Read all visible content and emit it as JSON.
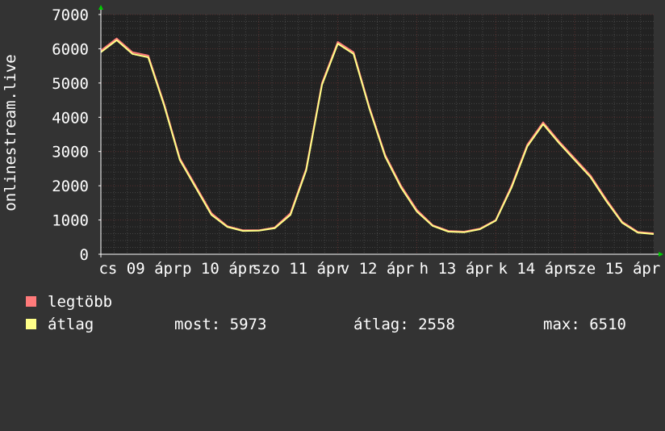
{
  "chart_data": {
    "type": "line",
    "ylabel": "onlinestream.live",
    "ylim": [
      0,
      7000
    ],
    "yticks": [
      0,
      1000,
      2000,
      3000,
      4000,
      5000,
      6000,
      7000
    ],
    "xticks": [
      "cs 09 ápr",
      "p 10 ápr",
      "szo 11 ápr",
      "v 12 ápr",
      "h 13 ápr",
      "k 14 ápr",
      "sze 15 ápr"
    ],
    "grid": true,
    "colors": {
      "background": "#333333",
      "plot": "#222222",
      "grid_major": "#5a3030",
      "grid_minor": "#444444",
      "axis": "#ffffff",
      "max_series": "#ff7a7a",
      "avg_series": "#ffff88"
    },
    "series": [
      {
        "name": "legtöbb",
        "color": "#ff7a7a",
        "x": [
          0.0,
          0.2,
          0.4,
          0.6,
          0.8,
          1.0,
          1.2,
          1.4,
          1.6,
          1.8,
          2.0,
          2.2,
          2.4,
          2.6,
          2.8,
          3.0,
          3.2,
          3.4,
          3.6,
          3.8,
          4.0,
          4.2,
          4.4,
          4.6,
          4.8,
          5.0,
          5.2,
          5.4,
          5.6,
          5.8,
          6.0,
          6.2,
          6.4,
          6.6,
          6.8,
          7.0
        ],
        "values": [
          5950,
          6300,
          5900,
          5800,
          4400,
          2800,
          2000,
          1200,
          820,
          700,
          700,
          780,
          1200,
          2500,
          5000,
          6200,
          5900,
          4300,
          2900,
          2000,
          1300,
          850,
          680,
          660,
          750,
          1000,
          2000,
          3200,
          3850,
          3300,
          2800,
          2300,
          1600,
          950,
          650,
          610
        ]
      },
      {
        "name": "átlag",
        "color": "#ffff88",
        "x": [
          0.0,
          0.2,
          0.4,
          0.6,
          0.8,
          1.0,
          1.2,
          1.4,
          1.6,
          1.8,
          2.0,
          2.2,
          2.4,
          2.6,
          2.8,
          3.0,
          3.2,
          3.4,
          3.6,
          3.8,
          4.0,
          4.2,
          4.4,
          4.6,
          4.8,
          5.0,
          5.2,
          5.4,
          5.6,
          5.8,
          6.0,
          6.2,
          6.4,
          6.6,
          6.8,
          7.0
        ],
        "values": [
          5900,
          6250,
          5850,
          5750,
          4350,
          2750,
          1950,
          1150,
          800,
          680,
          690,
          760,
          1150,
          2450,
          4950,
          6150,
          5850,
          4250,
          2850,
          1950,
          1250,
          830,
          660,
          640,
          730,
          980,
          1950,
          3150,
          3800,
          3250,
          2750,
          2250,
          1550,
          920,
          630,
          590
        ]
      }
    ]
  },
  "legend": {
    "items": [
      {
        "label": "legtöbb",
        "color": "#ff7a7a"
      },
      {
        "label": "átlag",
        "color": "#ffff88"
      }
    ],
    "stats": {
      "now": "most: 5973",
      "avg": "átlag: 2558",
      "max": "max: 6510"
    }
  }
}
